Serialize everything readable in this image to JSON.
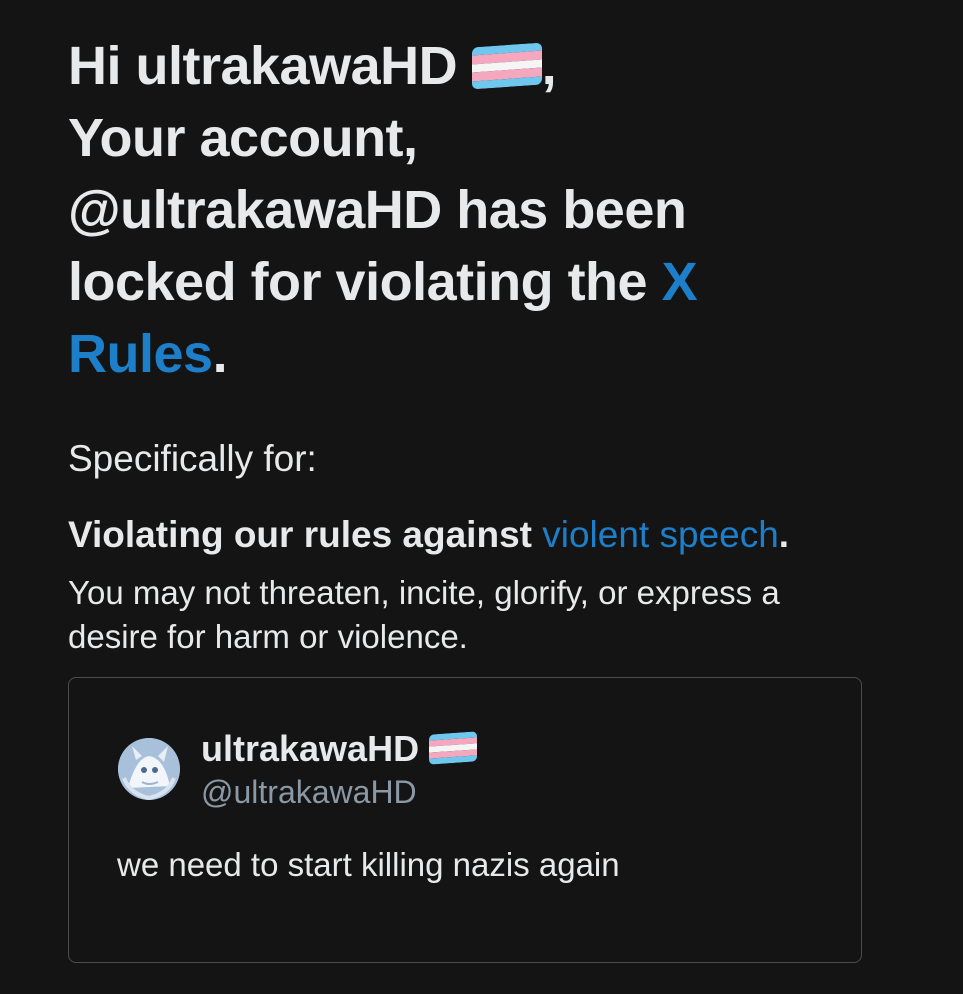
{
  "headline": {
    "line1_prefix": "Hi ultrakawaHD ",
    "line1_suffix": ",",
    "line2": "Your account,",
    "line3": "@ultrakawaHD has been",
    "line4_prefix": "locked for violating the ",
    "rules_link_line4": "X",
    "rules_link_line5": "Rules",
    "line5_suffix": "."
  },
  "reason": {
    "intro": "Specifically for:",
    "violation_prefix": "Violating our rules against ",
    "violation_link": "violent speech",
    "violation_suffix": ".",
    "description": "You may not threaten, incite, glorify, or express a desire for harm or violence."
  },
  "tweet": {
    "display_name": "ultrakawaHD ",
    "handle": "@ultrakawaHD",
    "text": "we need to start killing nazis again",
    "avatar_icon": "avatar-image"
  },
  "colors": {
    "background": "#141414",
    "text": "#e7e9ea",
    "link": "#1d7ec9",
    "muted": "#8b98a5",
    "card_border": "#4a4d50"
  },
  "icons": {
    "flag": "transgender-flag-icon"
  }
}
